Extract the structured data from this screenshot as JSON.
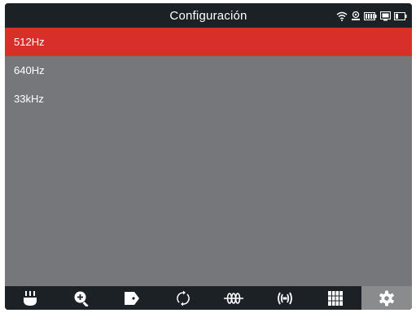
{
  "header": {
    "title": "Configuración",
    "status_icons": [
      "wifi-icon",
      "gps-icon",
      "battery-full-icon",
      "device-icon",
      "battery-low-icon"
    ]
  },
  "list": {
    "items": [
      {
        "label": "512Hz",
        "selected": true
      },
      {
        "label": "640Hz",
        "selected": false
      },
      {
        "label": "33kHz",
        "selected": false
      }
    ]
  },
  "toolbar": {
    "items": [
      {
        "icon": "locator-icon",
        "active": false
      },
      {
        "icon": "zoom-in-icon",
        "active": false
      },
      {
        "icon": "tag-icon",
        "active": false
      },
      {
        "icon": "refresh-icon",
        "active": false
      },
      {
        "icon": "coil-icon",
        "active": false
      },
      {
        "icon": "signal-icon",
        "active": false
      },
      {
        "icon": "grid-icon",
        "active": false
      },
      {
        "icon": "gear-icon",
        "active": true
      }
    ]
  },
  "colors": {
    "accent": "#d92f2b",
    "background": "#76777a",
    "bar": "#1c2126",
    "active_tab": "#8a8b8d"
  }
}
